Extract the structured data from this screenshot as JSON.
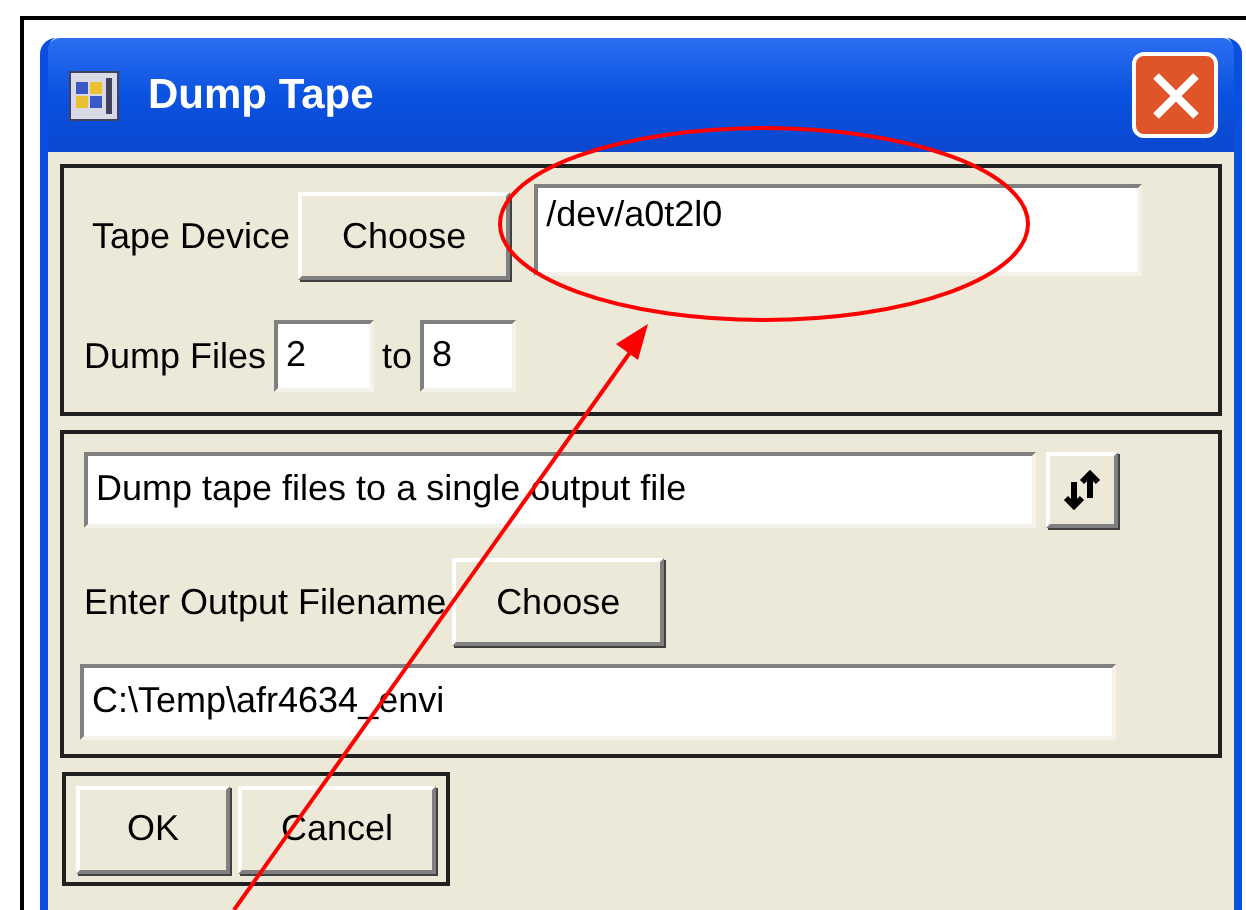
{
  "window": {
    "title": "Dump Tape"
  },
  "tape_device": {
    "label": "Tape Device",
    "choose_button": "Choose",
    "value": "/dev/a0t2l0"
  },
  "dump_files": {
    "label": "Dump Files",
    "from": "2",
    "separator": "to",
    "to": "8"
  },
  "output_mode": {
    "value": "Dump tape files to a single output file"
  },
  "output_filename": {
    "label": "Enter Output Filename",
    "choose_button": "Choose",
    "value": "C:\\Temp\\afr4634_envi"
  },
  "buttons": [
    "OK",
    "Cancel"
  ]
}
